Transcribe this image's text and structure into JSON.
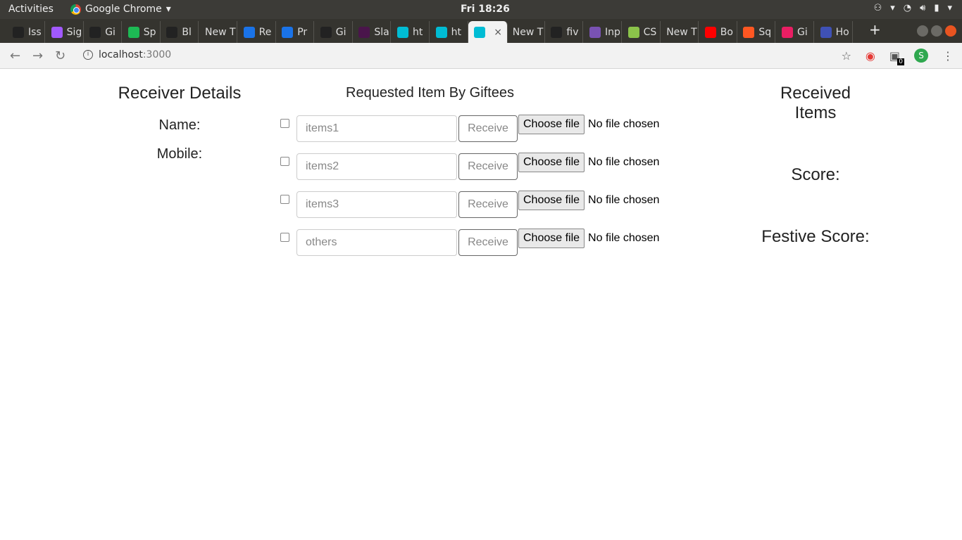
{
  "system": {
    "activities": "Activities",
    "app_name": "Google Chrome",
    "clock": "Fri 18:26"
  },
  "tabs": [
    {
      "label": "Iss",
      "color": "#222222"
    },
    {
      "label": "Sig",
      "color": "#a259ff"
    },
    {
      "label": "Gi",
      "color": "#222222"
    },
    {
      "label": "Sp",
      "color": "#1db954"
    },
    {
      "label": "Bl",
      "color": "#222222"
    },
    {
      "label": "New T",
      "color": ""
    },
    {
      "label": "Re",
      "color": "#1a73e8"
    },
    {
      "label": "Pr",
      "color": "#1a73e8"
    },
    {
      "label": "Gi",
      "color": "#222222"
    },
    {
      "label": "Sla",
      "color": "#4a154b"
    },
    {
      "label": "ht",
      "color": "#00bcd4"
    },
    {
      "label": "ht",
      "color": "#00bcd4"
    },
    {
      "label": "",
      "color": "#00bcd4",
      "active": true
    },
    {
      "label": "New T",
      "color": ""
    },
    {
      "label": "fiv",
      "color": "#222222"
    },
    {
      "label": "Inp",
      "color": "#7952b3"
    },
    {
      "label": "CS",
      "color": "#8bc34a"
    },
    {
      "label": "New T",
      "color": ""
    },
    {
      "label": "Bo",
      "color": "#ff0000"
    },
    {
      "label": "Sq",
      "color": "#ff5722"
    },
    {
      "label": "Gi",
      "color": "#e91e63"
    },
    {
      "label": "Ho",
      "color": "#3f51b5"
    }
  ],
  "tab_close": "×",
  "new_tab": "+",
  "address": {
    "host": "localhost",
    "port": ":3000"
  },
  "extension_badge": "0",
  "profile_initial": "S",
  "receiver": {
    "title": "Receiver Details",
    "name_label": "Name:",
    "mobile_label": "Mobile:"
  },
  "requested": {
    "title": "Requested Item By Giftees",
    "rows": [
      {
        "placeholder": "items1",
        "button": "Receive",
        "file_button": "Choose file",
        "file_status": "No file chosen"
      },
      {
        "placeholder": "items2",
        "button": "Receive",
        "file_button": "Choose file",
        "file_status": "No file chosen"
      },
      {
        "placeholder": "items3",
        "button": "Receive",
        "file_button": "Choose file",
        "file_status": "No file chosen"
      },
      {
        "placeholder": "others",
        "button": "Receive",
        "file_button": "Choose file",
        "file_status": "No file chosen"
      }
    ]
  },
  "received": {
    "title_line1": "Received",
    "title_line2": "Items",
    "score_label": "Score:",
    "festive_label": "Festive Score:"
  }
}
